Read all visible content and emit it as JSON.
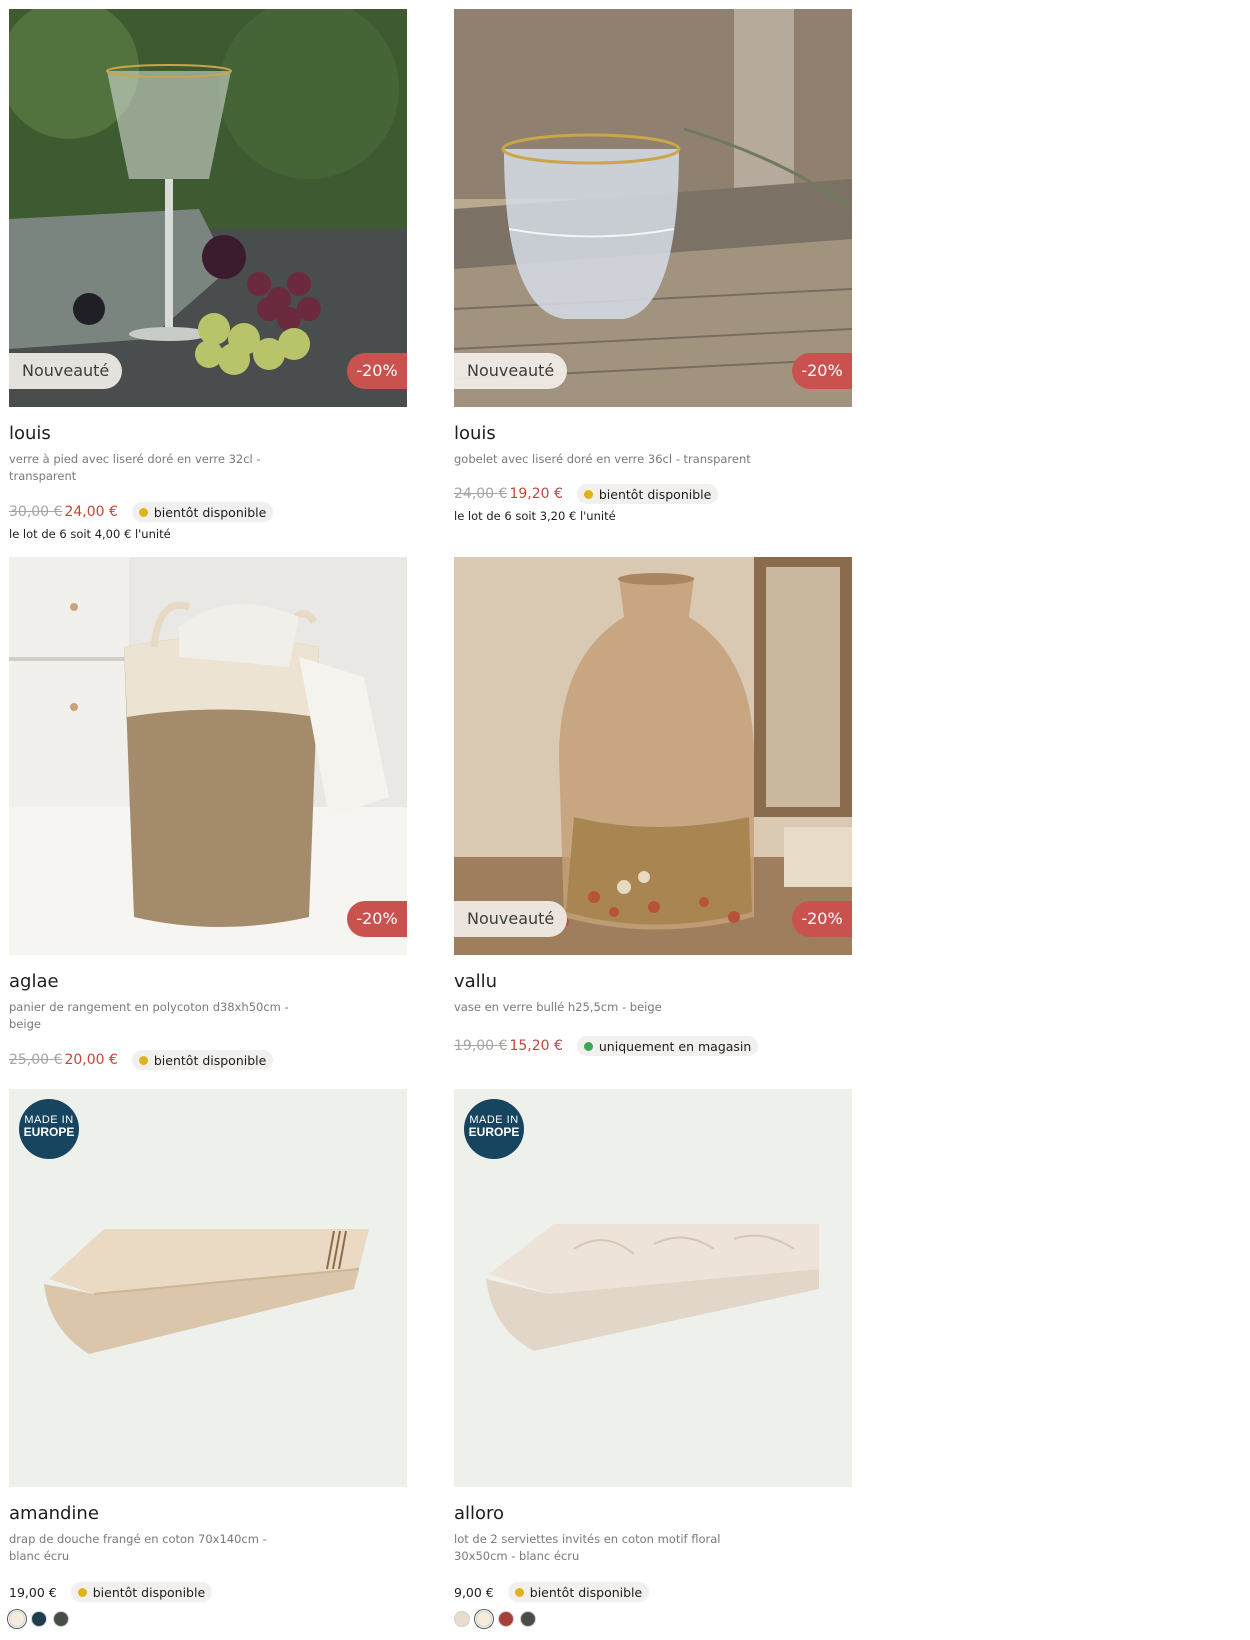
{
  "products": [
    {
      "name": "louis",
      "desc": "verre à pied avec liseré doré en verre 32cl - transparent",
      "new_tag": "Nouveauté",
      "discount": "-20%",
      "old_price": "30,00 €",
      "price": "24,00 €",
      "status": "bientôt disponible",
      "status_color": "#e0b21b",
      "unit_note": "le lot de 6 soit 4,00 € l'unité"
    },
    {
      "name": "louis",
      "desc": "gobelet avec liseré doré en verre 36cl - transparent",
      "new_tag": "Nouveauté",
      "discount": "-20%",
      "old_price": "24,00 €",
      "price": "19,20 €",
      "status": "bientôt disponible",
      "status_color": "#e0b21b",
      "unit_note": "le lot de 6 soit 3,20 € l'unité"
    },
    {
      "name": "aglae",
      "desc": "panier de rangement en polycoton d38xh50cm - beige",
      "discount": "-20%",
      "old_price": "25,00 €",
      "price": "20,00 €",
      "status": "bientôt disponible",
      "status_color": "#e0b21b"
    },
    {
      "name": "vallu",
      "desc": "vase en verre bullé h25,5cm - beige",
      "new_tag": "Nouveauté",
      "discount": "-20%",
      "old_price": "19,00 €",
      "price": "15,20 €",
      "status": "uniquement en magasin",
      "status_color": "#3aa65a"
    },
    {
      "name": "amandine",
      "desc": "drap de douche frangé en coton 70x140cm - blanc écru",
      "badge_line1": "MADE IN",
      "badge_line2": "EUROPE",
      "price": "19,00 €",
      "status": "bientôt disponible",
      "status_color": "#e0b21b",
      "swatches": [
        "#f5ecdc",
        "#1e3d4c",
        "#474e48"
      ]
    },
    {
      "name": "alloro",
      "desc": "lot de 2 serviettes invités en coton motif floral 30x50cm - blanc écru",
      "badge_line1": "MADE IN",
      "badge_line2": "EUROPE",
      "price": "9,00 €",
      "status": "bientôt disponible",
      "status_color": "#e0b21b",
      "swatches": [
        "#e7dccd",
        "#f5ecdc",
        "#a8403a",
        "#474e48"
      ]
    }
  ]
}
